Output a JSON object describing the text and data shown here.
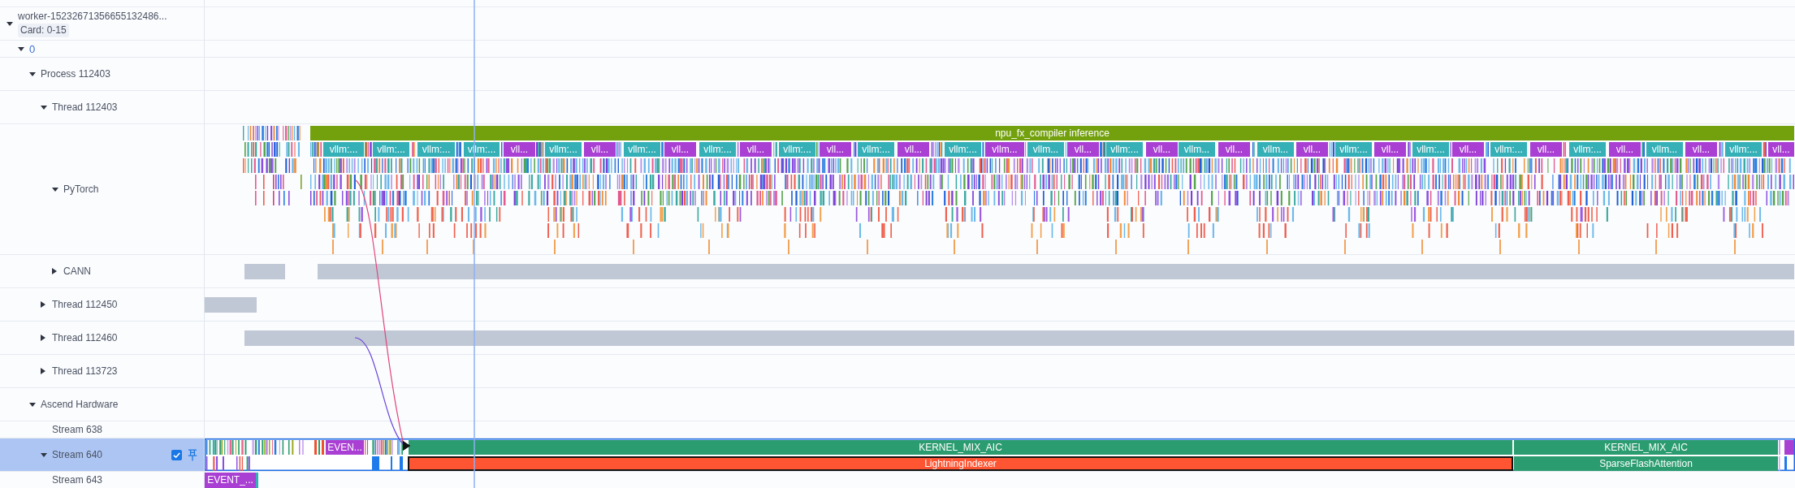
{
  "tree": [
    {
      "label": "worker-15232671356655132486...",
      "badge": "Card: 0-15",
      "expanded": true,
      "selected": false,
      "children": [
        {
          "kind": "rank",
          "label": "0",
          "expanded": true,
          "selected": false,
          "children": [
            {
              "label": "Process 112403",
              "expanded": true,
              "selected": false,
              "children": [
                {
                  "label": "Thread 112403",
                  "expanded": true,
                  "selected": false,
                  "children": [
                    {
                      "kind": "layer",
                      "label": "PyTorch",
                      "expanded": true,
                      "selected": false,
                      "lanes": [
                        {
                          "slices": [
                            {
                              "label": "npu_fx_compiler inference",
                              "color": "#73a10e",
                              "selected": false
                            }
                          ]
                        },
                        {
                          "slices": [
                            {
                              "label": "vllm:...",
                              "color": "#35b0b7",
                              "selected": false
                            },
                            {
                              "label": "vllm:...",
                              "color": "#35b0b7",
                              "selected": false
                            },
                            {
                              "label": "vllm:...",
                              "color": "#35b0b7",
                              "selected": false
                            },
                            {
                              "label": "vllm:...",
                              "color": "#35b0b7",
                              "selected": false
                            },
                            {
                              "label": "vll...",
                              "color": "#a93fd3",
                              "selected": false
                            },
                            {
                              "label": "vllm:...",
                              "color": "#35b0b7",
                              "selected": false
                            },
                            {
                              "label": "vll...",
                              "color": "#a93fd3",
                              "selected": false
                            },
                            {
                              "label": "vllm:...",
                              "color": "#35b0b7",
                              "selected": false
                            },
                            {
                              "label": "vll...",
                              "color": "#a93fd3",
                              "selected": false
                            },
                            {
                              "label": "vllm:...",
                              "color": "#35b0b7",
                              "selected": false
                            },
                            {
                              "label": "vll...",
                              "color": "#a93fd3",
                              "selected": false
                            },
                            {
                              "label": "vllm:...",
                              "color": "#35b0b7",
                              "selected": false
                            },
                            {
                              "label": "vll...",
                              "color": "#a93fd3",
                              "selected": false
                            },
                            {
                              "label": "vllm:...",
                              "color": "#35b0b7",
                              "selected": false
                            },
                            {
                              "label": "vll...",
                              "color": "#a93fd3",
                              "selected": false
                            },
                            {
                              "label": "vllm:...",
                              "color": "#35b0b7",
                              "selected": false
                            },
                            {
                              "label": "vllm...",
                              "color": "#a93fd3",
                              "selected": false
                            },
                            {
                              "label": "vllm...",
                              "color": "#35b0b7",
                              "selected": false
                            },
                            {
                              "label": "vll...",
                              "color": "#a93fd3",
                              "selected": false
                            },
                            {
                              "label": "vllm:...",
                              "color": "#35b0b7",
                              "selected": false
                            },
                            {
                              "label": "vll...",
                              "color": "#a93fd3",
                              "selected": false
                            },
                            {
                              "label": "vllm...",
                              "color": "#35b0b7",
                              "selected": false
                            },
                            {
                              "label": "vll...",
                              "color": "#a93fd3",
                              "selected": false
                            },
                            {
                              "label": "vllm...",
                              "color": "#35b0b7",
                              "selected": false
                            },
                            {
                              "label": "vll...",
                              "color": "#a93fd3",
                              "selected": false
                            },
                            {
                              "label": "vllm:...",
                              "color": "#35b0b7",
                              "selected": false
                            },
                            {
                              "label": "vll...",
                              "color": "#a93fd3",
                              "selected": false
                            },
                            {
                              "label": "vllm:...",
                              "color": "#35b0b7",
                              "selected": false
                            },
                            {
                              "label": "vll...",
                              "color": "#a93fd3",
                              "selected": false
                            },
                            {
                              "label": "vllm:...",
                              "color": "#35b0b7",
                              "selected": false
                            },
                            {
                              "label": "vll...",
                              "color": "#a93fd3",
                              "selected": false
                            },
                            {
                              "label": "vllm:...",
                              "color": "#35b0b7",
                              "selected": false
                            },
                            {
                              "label": "vll...",
                              "color": "#a93fd3",
                              "selected": false
                            },
                            {
                              "label": "vllm...",
                              "color": "#35b0b7",
                              "selected": false
                            },
                            {
                              "label": "vll...",
                              "color": "#a93fd3",
                              "selected": false
                            },
                            {
                              "label": "vllm:...",
                              "color": "#35b0b7",
                              "selected": false
                            },
                            {
                              "label": "vll...",
                              "color": "#a93fd3",
                              "selected": false
                            }
                          ]
                        }
                      ]
                    },
                    {
                      "label": "CANN",
                      "expanded": false,
                      "selected": false
                    }
                  ]
                },
                {
                  "label": "Thread 112450",
                  "expanded": false,
                  "selected": false
                },
                {
                  "label": "Thread 112460",
                  "expanded": false,
                  "selected": false
                },
                {
                  "label": "Thread 113723",
                  "expanded": false,
                  "selected": false
                }
              ]
            },
            {
              "label": "Ascend Hardware",
              "expanded": true,
              "selected": false,
              "children": [
                {
                  "kind": "stream",
                  "label": "Stream 638",
                  "selected": false
                },
                {
                  "kind": "stream",
                  "label": "Stream 640",
                  "expanded": true,
                  "selected": true,
                  "checked": true,
                  "lanes": [
                    {
                      "slices": [
                        {
                          "label": "EVEN...",
                          "color": "#a93fd3",
                          "selected": false
                        },
                        {
                          "label": "KERNEL_MIX_AIC",
                          "color": "#2b9c70",
                          "selected": false
                        },
                        {
                          "label": "KERNEL_MIX_AIC",
                          "color": "#2b9c70",
                          "selected": false
                        }
                      ]
                    },
                    {
                      "slices": [
                        {
                          "label": "LightningIndexer",
                          "color": "#ff5533",
                          "selected": true
                        },
                        {
                          "label": "SparseFlashAttention",
                          "color": "#2b9c70",
                          "selected": false
                        }
                      ]
                    }
                  ]
                },
                {
                  "kind": "stream",
                  "label": "Stream 643",
                  "selected": false,
                  "lanes": [
                    {
                      "slices": [
                        {
                          "label": "EVENT_...",
                          "color": "#a93fd3",
                          "selected": false
                        }
                      ]
                    }
                  ]
                }
              ]
            }
          ]
        }
      ]
    }
  ]
}
